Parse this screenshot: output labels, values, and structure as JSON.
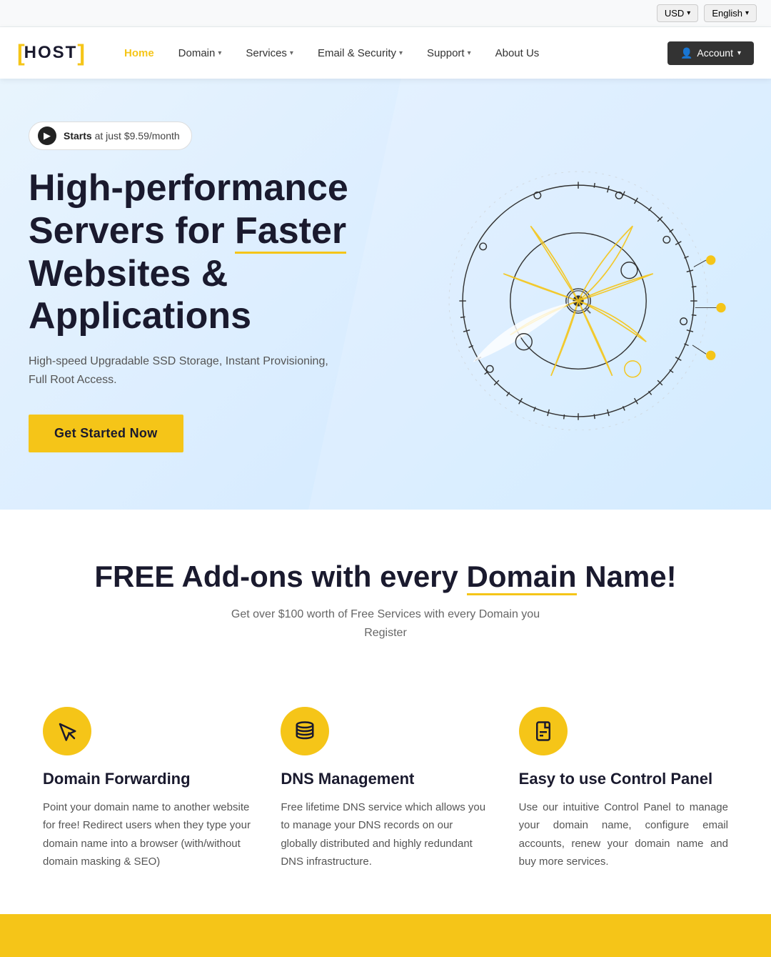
{
  "topbar": {
    "currency_label": "USD",
    "language_label": "English"
  },
  "navbar": {
    "logo_text": "HOST",
    "links": [
      {
        "label": "Home",
        "active": true,
        "has_arrow": false
      },
      {
        "label": "Domain",
        "active": false,
        "has_arrow": true
      },
      {
        "label": "Services",
        "active": false,
        "has_arrow": true
      },
      {
        "label": "Email & Security",
        "active": false,
        "has_arrow": true
      },
      {
        "label": "Support",
        "active": false,
        "has_arrow": true
      },
      {
        "label": "About Us",
        "active": false,
        "has_arrow": false
      }
    ],
    "account_label": "Account"
  },
  "hero": {
    "badge_starts": "Starts",
    "badge_price": "at just $9.59/month",
    "title_line1": "High-performance",
    "title_line2_pre": "Servers for ",
    "title_line2_highlight": "Faster",
    "title_line3": "Websites &",
    "title_line4": "Applications",
    "subtitle": "High-speed Upgradable SSD Storage, Instant Provisioning, Full Root Access.",
    "cta_label": "Get Started Now"
  },
  "free_section": {
    "title_pre": "FREE Add-ons with every ",
    "title_highlight": "Domain",
    "title_post": " Name!",
    "subtitle_line1": "Get over $100 worth of Free Services with every Domain you",
    "subtitle_line2": "Register"
  },
  "features": [
    {
      "icon": "cursor",
      "title": "Domain Forwarding",
      "description": "Point your domain name to another website for free! Redirect users when they type your domain name into a browser (with/without domain masking & SEO)"
    },
    {
      "icon": "database",
      "title": "DNS Management",
      "description": "Free lifetime DNS service which allows you to manage your DNS records on our globally distributed and highly redundant DNS infrastructure."
    },
    {
      "icon": "document",
      "title": "Easy to use Control Panel",
      "description": "Use our intuitive Control Panel to manage your domain name, configure email accounts, renew your domain name and buy more services."
    }
  ],
  "colors": {
    "yellow": "#f5c518",
    "dark": "#1a1a2e",
    "light_blue_bg": "#e8f4fd"
  }
}
